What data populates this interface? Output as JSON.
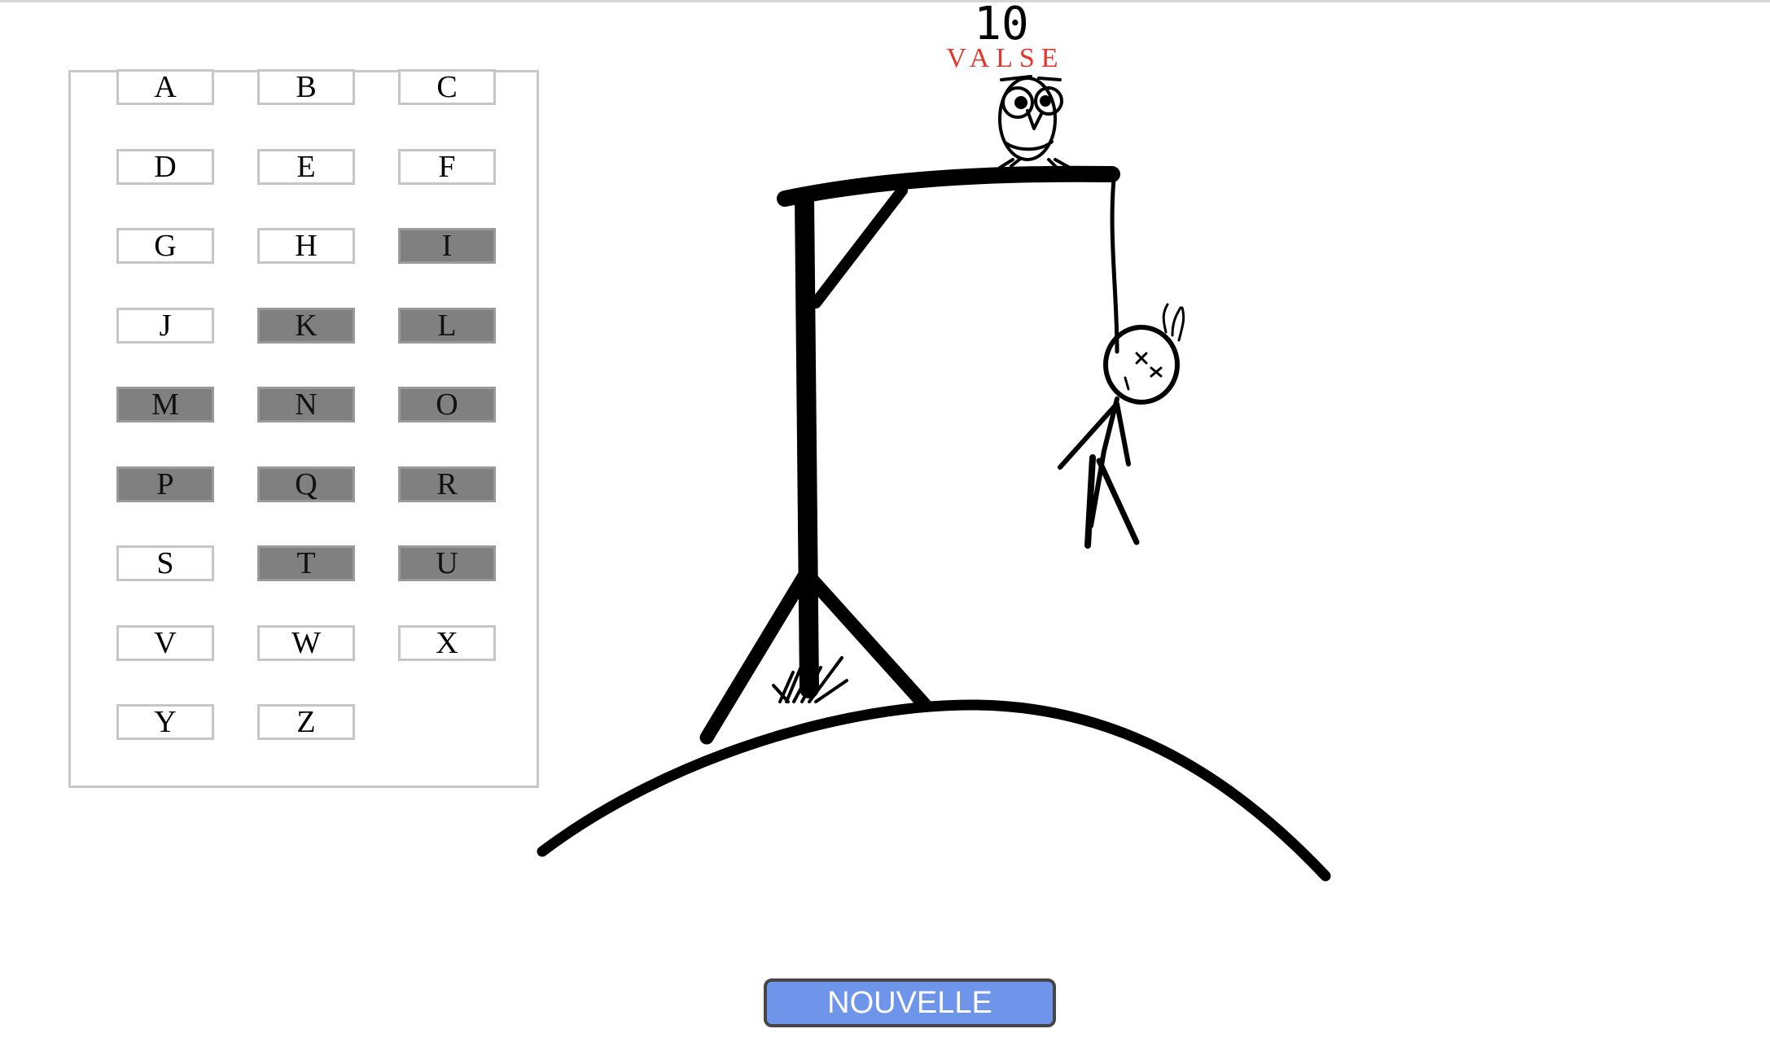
{
  "game": {
    "score": "10",
    "word": "VALSE"
  },
  "keyboard": {
    "letters": [
      {
        "letter": "A",
        "used": false
      },
      {
        "letter": "B",
        "used": false
      },
      {
        "letter": "C",
        "used": false
      },
      {
        "letter": "D",
        "used": false
      },
      {
        "letter": "E",
        "used": false
      },
      {
        "letter": "F",
        "used": false
      },
      {
        "letter": "G",
        "used": false
      },
      {
        "letter": "H",
        "used": false
      },
      {
        "letter": "I",
        "used": true
      },
      {
        "letter": "J",
        "used": false
      },
      {
        "letter": "K",
        "used": true
      },
      {
        "letter": "L",
        "used": true
      },
      {
        "letter": "M",
        "used": true
      },
      {
        "letter": "N",
        "used": true
      },
      {
        "letter": "O",
        "used": true
      },
      {
        "letter": "P",
        "used": true
      },
      {
        "letter": "Q",
        "used": true
      },
      {
        "letter": "R",
        "used": true
      },
      {
        "letter": "S",
        "used": false
      },
      {
        "letter": "T",
        "used": true
      },
      {
        "letter": "U",
        "used": true
      },
      {
        "letter": "V",
        "used": false
      },
      {
        "letter": "W",
        "used": false
      },
      {
        "letter": "X",
        "used": false
      },
      {
        "letter": "Y",
        "used": false
      },
      {
        "letter": "Z",
        "used": false
      }
    ]
  },
  "controls": {
    "new_game_label": "NOUVELLE"
  },
  "colors": {
    "word": "#e3352c",
    "used_key": "#808080",
    "button": "#6f95ea"
  }
}
